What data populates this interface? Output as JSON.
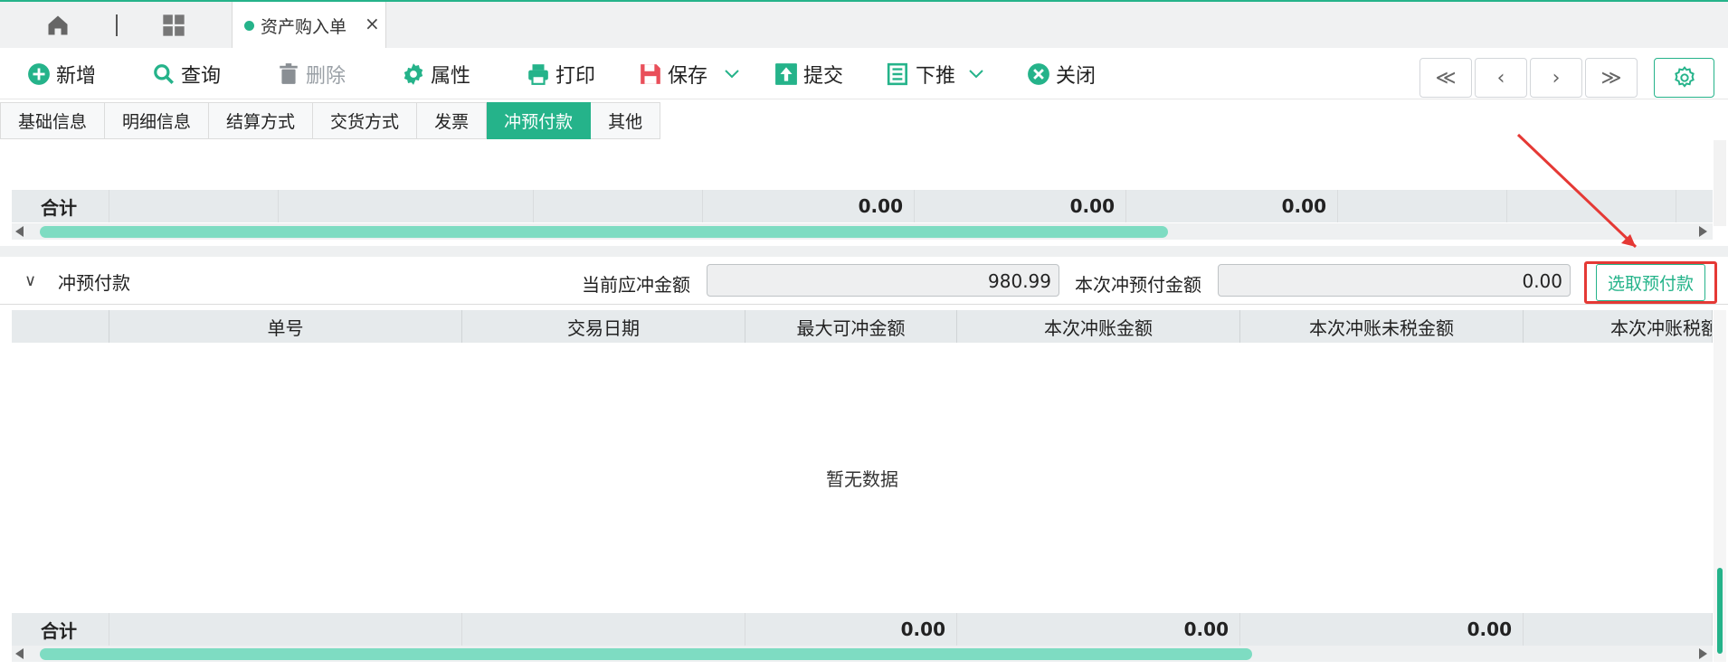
{
  "tabs": {
    "doc_tab_label": "资产购入单"
  },
  "toolbar": {
    "add": "新增",
    "query": "查询",
    "delete": "删除",
    "properties": "属性",
    "print": "打印",
    "save": "保存",
    "submit": "提交",
    "push_down": "下推",
    "close": "关闭"
  },
  "nav": {
    "first": "≪",
    "prev": "‹",
    "next": "›",
    "last": "≫"
  },
  "section_tabs": [
    "基础信息",
    "明细信息",
    "结算方式",
    "交货方式",
    "发票",
    "冲预付款",
    "其他"
  ],
  "active_section_tab": "冲预付款",
  "upper_grid": {
    "total_label": "合计",
    "totals": [
      "0.00",
      "0.00",
      "0.00"
    ]
  },
  "prepay": {
    "title": "冲预付款",
    "current_offset_label": "当前应冲金额",
    "current_offset_value": "980.99",
    "this_prepay_label": "本次冲预付金额",
    "this_prepay_value": "0.00",
    "select_button": "选取预付款"
  },
  "lower_grid": {
    "columns": [
      "单号",
      "交易日期",
      "最大可冲金额",
      "本次冲账金额",
      "本次冲账未税金额",
      "本次冲账税额"
    ],
    "empty_text": "暂无数据",
    "total_label": "合计",
    "totals": [
      "0.00",
      "0.00",
      "0.00"
    ]
  },
  "colors": {
    "accent": "#25b38a",
    "highlight": "#e53935",
    "scroll_thumb": "#7edcc2"
  }
}
